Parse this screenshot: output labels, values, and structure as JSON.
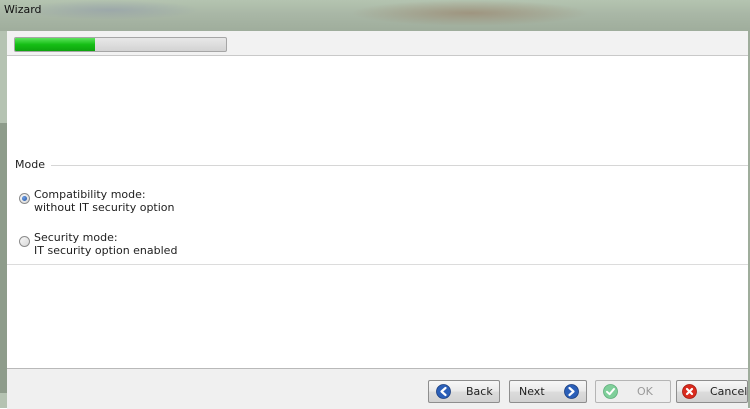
{
  "window": {
    "title": "Wizard"
  },
  "progress": {
    "fraction": 0.38
  },
  "group": {
    "label": "Mode",
    "options": [
      {
        "line1": "Compatibility mode:",
        "line2": "without IT security option",
        "selected": true
      },
      {
        "line1": "Security mode:",
        "line2": "IT security option enabled",
        "selected": false
      }
    ]
  },
  "footer": {
    "back_label": "Back",
    "next_label": "Next",
    "ok_label": "OK",
    "cancel_label": "Cancel",
    "ok_enabled": false
  },
  "icons": {
    "back": "arrow-left-circle-icon",
    "next": "arrow-right-circle-icon",
    "ok": "check-circle-icon",
    "cancel": "x-circle-icon"
  },
  "colors": {
    "progress": "#15bf15",
    "nav_icon": "#2b5fb8",
    "ok_icon": "#7fcf9a",
    "cancel_icon": "#d92b1e"
  }
}
